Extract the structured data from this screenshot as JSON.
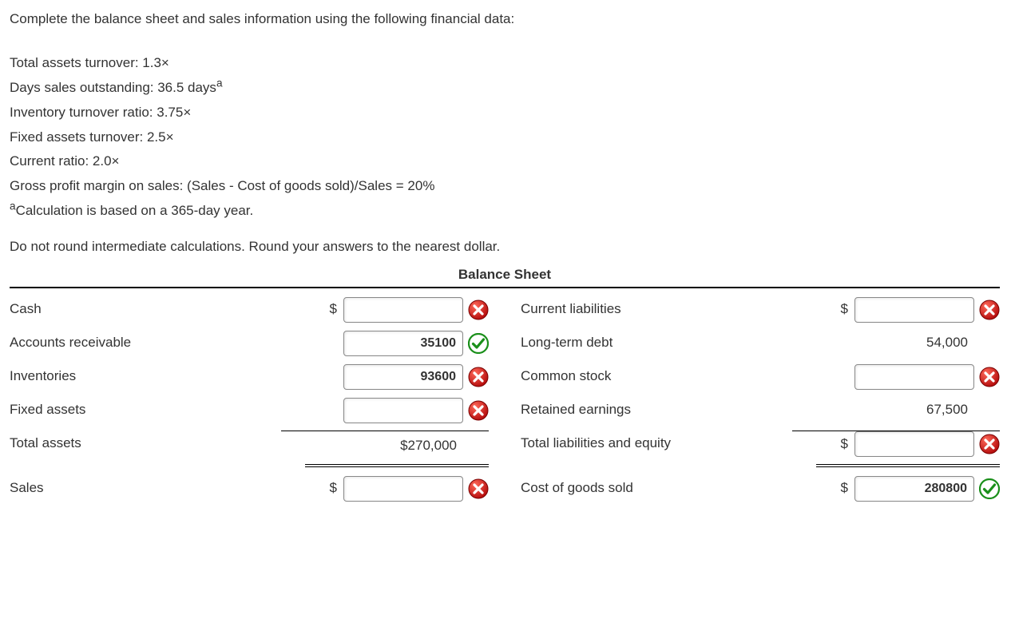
{
  "intro": {
    "line1": "Complete the balance sheet and sales information using the following financial data:",
    "d1": "Total assets turnover: 1.3×",
    "d2_a": "Days sales outstanding: 36.5 days",
    "d2_sup": "a",
    "d3": "Inventory turnover ratio: 3.75×",
    "d4": "Fixed assets turnover: 2.5×",
    "d5": "Current ratio: 2.0×",
    "d6": "Gross profit margin on sales: (Sales - Cost of goods sold)/Sales = 20%",
    "note_sup": "a",
    "note": "Calculation is based on a 365-day year.",
    "instr": "Do not round intermediate calculations. Round your answers to the nearest dollar."
  },
  "title": "Balance Sheet",
  "left": {
    "cash_label": "Cash",
    "cash_value": "",
    "ar_label": "Accounts receivable",
    "ar_value": "35100",
    "inv_label": "Inventories",
    "inv_value": "93600",
    "fa_label": "Fixed assets",
    "fa_value": "",
    "ta_label": "Total assets",
    "ta_value": "$270,000",
    "sales_label": "Sales",
    "sales_value": ""
  },
  "right": {
    "cl_label": "Current liabilities",
    "cl_value": "",
    "ltd_label": "Long-term debt",
    "ltd_value": "54,000",
    "cs_label": "Common stock",
    "cs_value": "",
    "re_label": "Retained earnings",
    "re_value": "67,500",
    "tle_label": "Total liabilities and equity",
    "tle_value": "",
    "cogs_label": "Cost of goods sold",
    "cogs_value": "280800"
  },
  "dollar": "$"
}
